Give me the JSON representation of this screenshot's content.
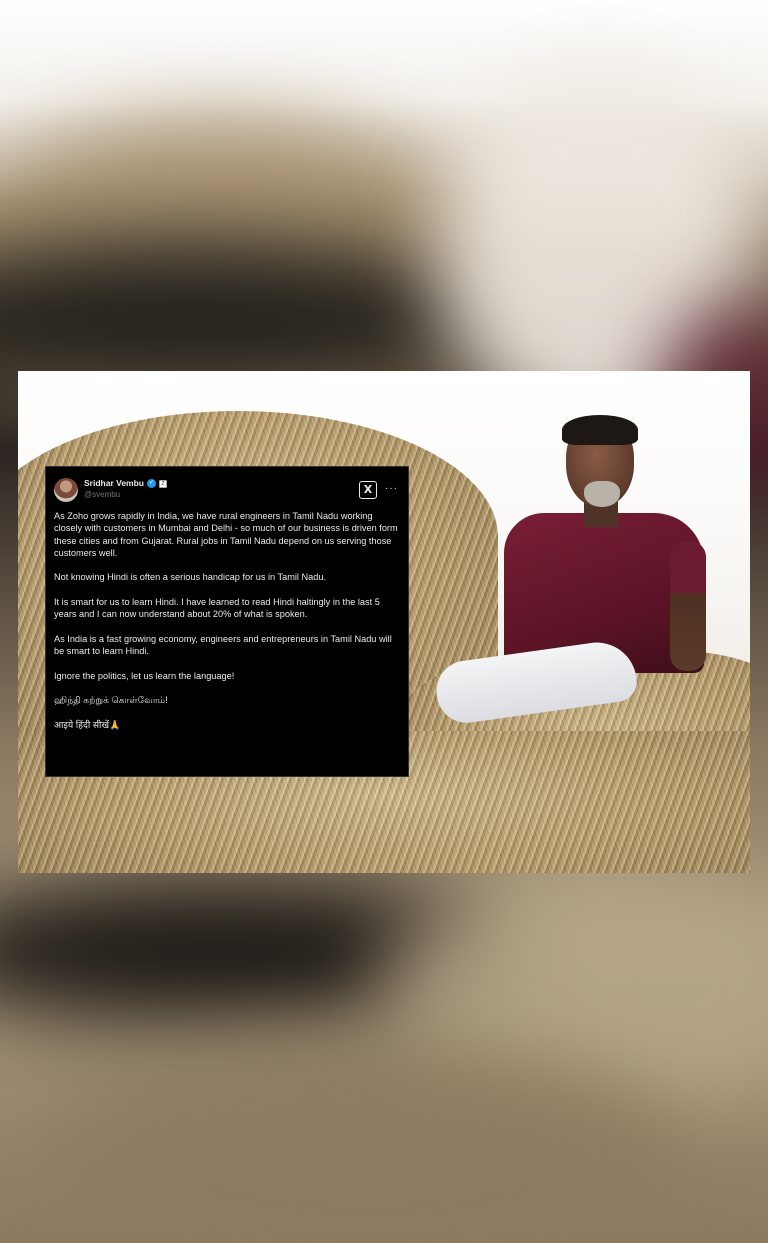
{
  "tweet": {
    "author_name": "Sridhar Vembu",
    "handle": "@svembu",
    "verified_badge": "✓",
    "affiliate_badge": "Z",
    "x_logo": "X",
    "more_label": "···",
    "paragraphs": [
      "As Zoho grows rapidly in India, we have rural engineers in Tamil Nadu working closely with customers in Mumbai and Delhi -  so much of our business is driven form these cities and from Gujarat. Rural jobs in Tamil Nadu depend on us serving those customers well.",
      "Not knowing Hindi is often a serious handicap for us in Tamil Nadu.",
      "It is smart for us to learn Hindi. I have learned to read Hindi haltingly in the last 5 years and I can now understand about 20% of what is spoken.",
      "As India is a fast growing economy, engineers and entrepreneurs in Tamil Nadu will be smart to learn Hindi.",
      "Ignore the politics, let us learn the language!",
      "ஹிந்தி கற்றுக் கொள்வோம்!",
      "आइये हिंदी सीखें🙏"
    ]
  },
  "icons": {
    "verified": "verified-badge-icon",
    "affiliate": "affiliate-badge-icon",
    "x": "x-logo-icon",
    "more": "more-options-icon"
  },
  "colors": {
    "tweet_background": "#000000",
    "tweet_text": "#e7e9ea",
    "handle_text": "#71767b",
    "verified_blue": "#1d9bf0",
    "shirt_maroon": "#6b1a2f"
  }
}
